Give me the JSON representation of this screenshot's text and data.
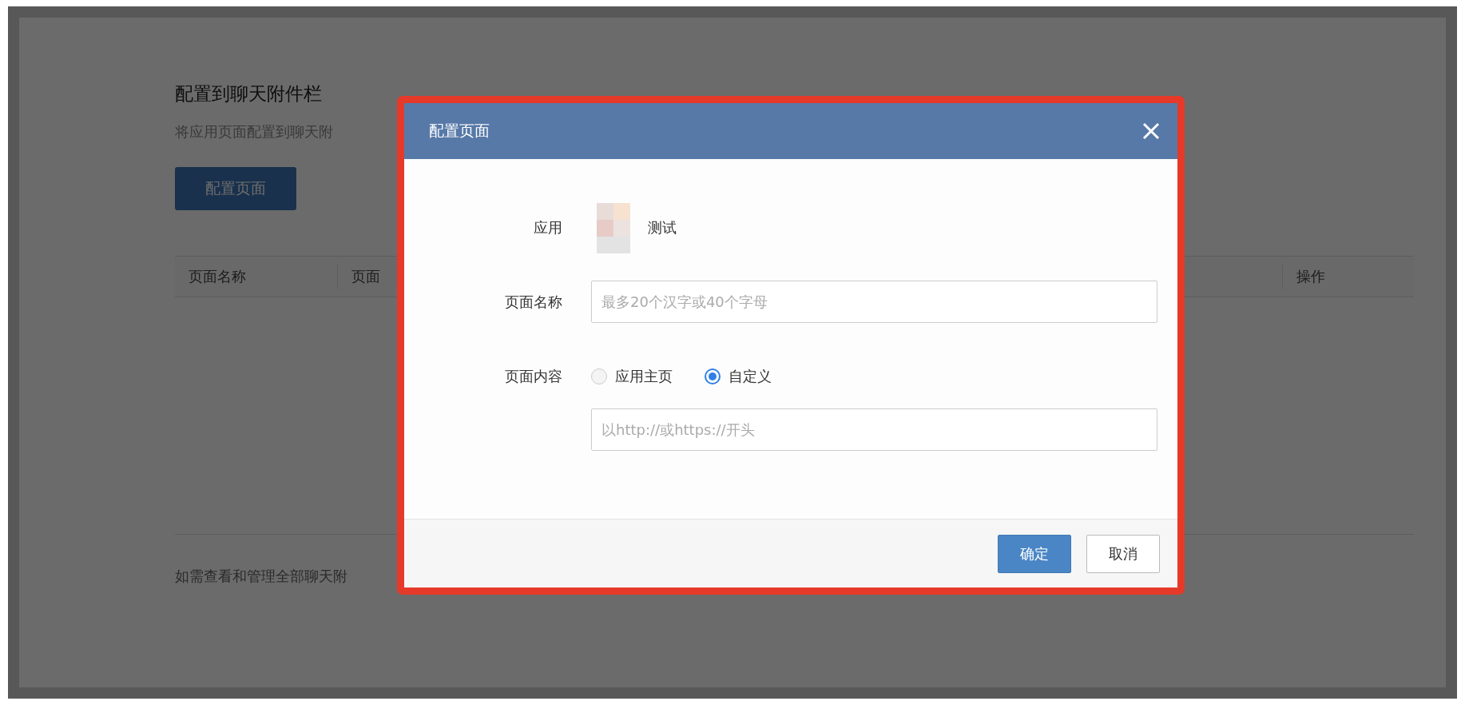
{
  "page": {
    "title": "配置到聊天附件栏",
    "description": "将应用页面配置到聊天附",
    "button": "配置页面",
    "table": {
      "columns": [
        "页面名称",
        "页面",
        "操作"
      ]
    },
    "footer_note": "如需查看和管理全部聊天附"
  },
  "dialog": {
    "title": "配置页面",
    "app": {
      "label": "应用",
      "name": "测试"
    },
    "name_field": {
      "label": "页面名称",
      "placeholder": "最多20个汉字或40个字母"
    },
    "content": {
      "label": "页面内容",
      "options": [
        {
          "label": "应用主页",
          "selected": false
        },
        {
          "label": "自定义",
          "selected": true
        }
      ],
      "url_placeholder": "以http://或https://开头"
    },
    "buttons": [
      {
        "label": "确定",
        "kind": "primary"
      },
      {
        "label": "取消",
        "kind": "default"
      }
    ]
  }
}
